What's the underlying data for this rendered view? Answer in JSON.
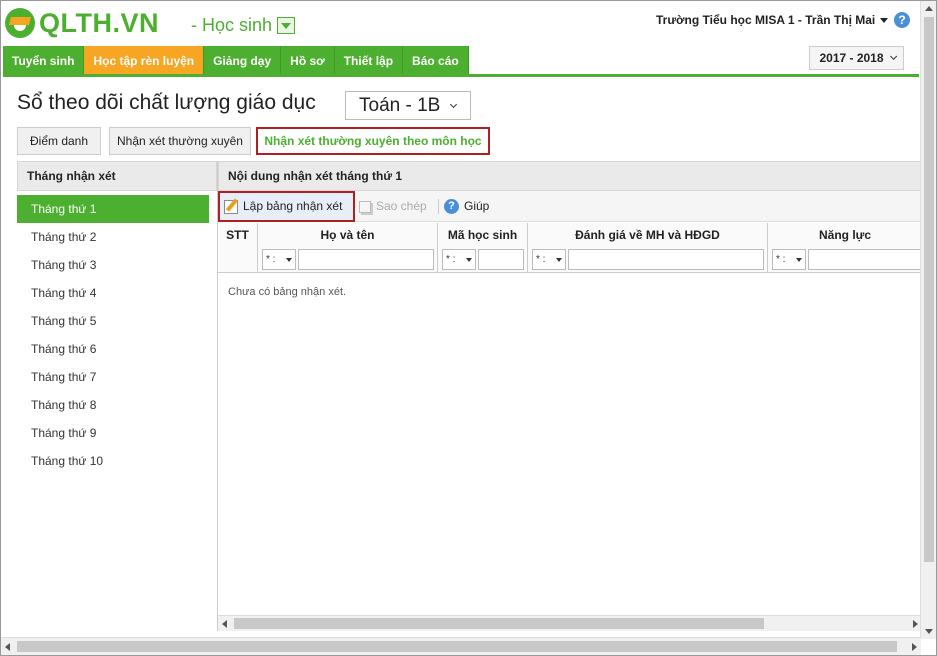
{
  "app": {
    "logo_text": "QLTH.VN",
    "role": "- Học sinh",
    "school_user": "Trường Tiểu học MISA 1 - Trần Thị Mai",
    "help_symbol": "?"
  },
  "nav": {
    "items": [
      {
        "label": "Tuyển sinh",
        "active": false
      },
      {
        "label": "Học tập rèn luyện",
        "active": true
      },
      {
        "label": "Giảng dạy",
        "active": false
      },
      {
        "label": "Hồ sơ",
        "active": false
      },
      {
        "label": "Thiết lập",
        "active": false
      },
      {
        "label": "Báo cáo",
        "active": false
      }
    ],
    "year": "2017 - 2018"
  },
  "page": {
    "title": "Sổ theo dõi chất lượng giáo dục",
    "subject": "Toán - 1B"
  },
  "tabs": [
    {
      "label": "Điểm danh",
      "active": false
    },
    {
      "label": "Nhận xét thường xuyên",
      "active": false
    },
    {
      "label": "Nhận xét thường xuyên theo môn học",
      "active": true
    }
  ],
  "left_panel": {
    "header": "Tháng nhận xét",
    "months": [
      "Tháng thứ 1",
      "Tháng thứ 2",
      "Tháng thứ 3",
      "Tháng thứ 4",
      "Tháng thứ 5",
      "Tháng thứ 6",
      "Tháng thứ 7",
      "Tháng thứ 8",
      "Tháng thứ 9",
      "Tháng thứ 10"
    ],
    "selected": "Tháng thứ 1"
  },
  "right_panel": {
    "header": "Nội dung nhận xét tháng thứ 1",
    "toolbar": {
      "create_label": "Lập bảng nhận xét",
      "copy_label": "Sao chép",
      "help_label": "Giúp"
    },
    "columns": [
      "STT",
      "Họ và tên",
      "Mã học sinh",
      "Đánh giá về MH và HĐGD",
      "Năng lực"
    ],
    "filter_op": "* :",
    "empty_message": "Chưa có bảng nhận xét."
  },
  "colors": {
    "brand_green": "#4caf2f",
    "active_orange": "#f6a623",
    "highlight_red": "#b02020"
  }
}
